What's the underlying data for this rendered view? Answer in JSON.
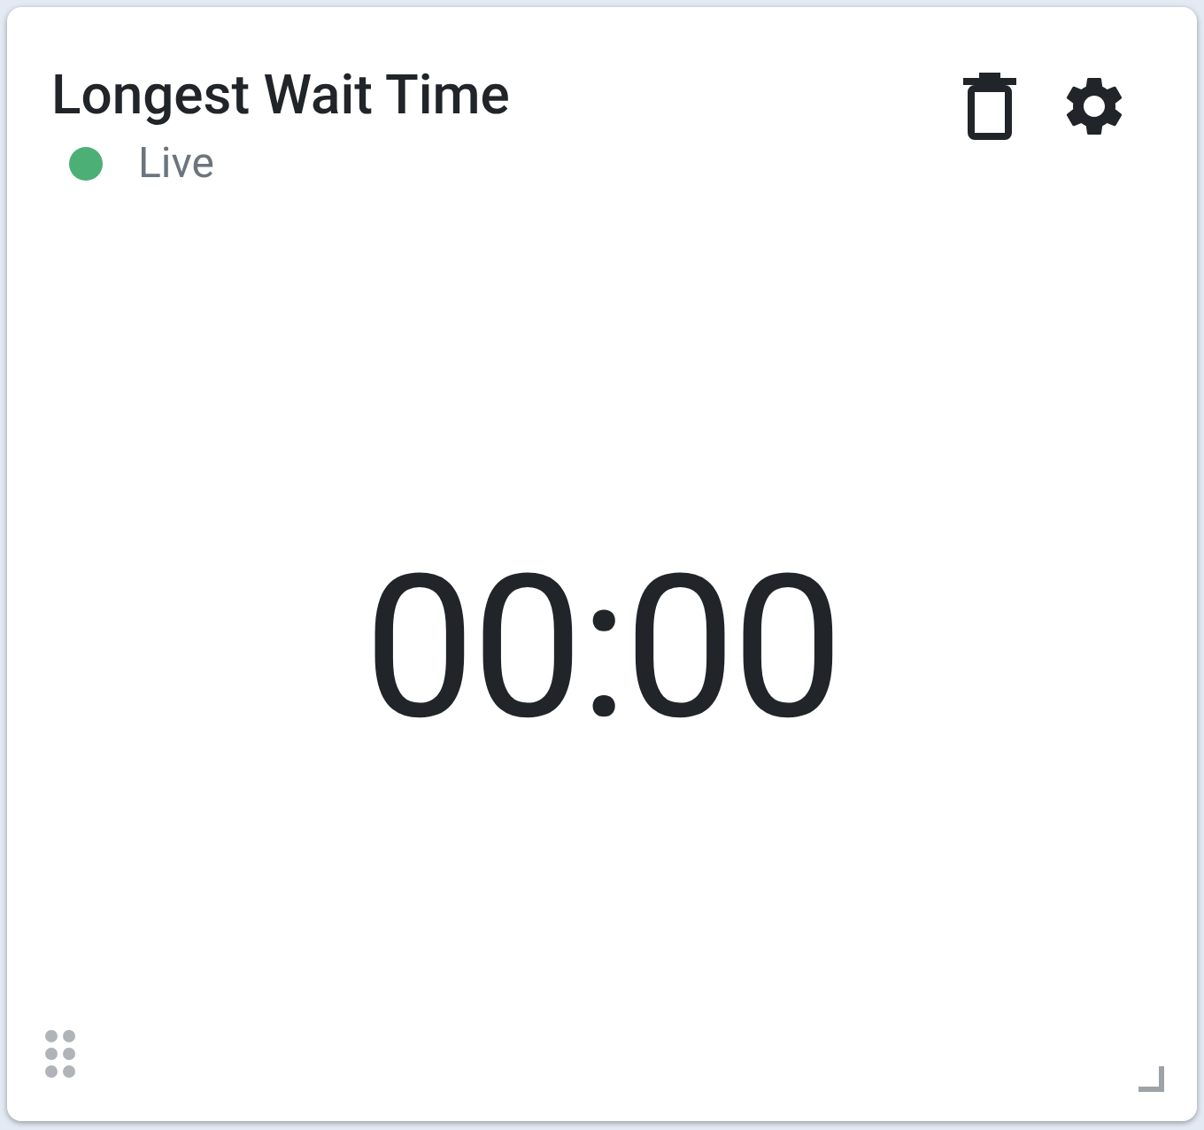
{
  "widget": {
    "title": "Longest Wait Time",
    "status": {
      "label": "Live",
      "color": "#4caf76"
    },
    "value": "00:00"
  }
}
